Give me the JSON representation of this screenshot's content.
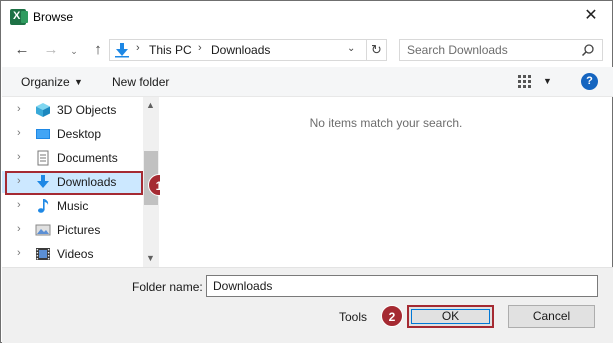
{
  "window": {
    "title": "Browse",
    "app_icon": "excel-icon",
    "close_glyph": "✕"
  },
  "navigation": {
    "back_glyph": "←",
    "forward_glyph": "→",
    "recent_glyph": "⌄",
    "up_glyph": "↑"
  },
  "address": {
    "icon": "downloads-folder-icon",
    "crumbs": [
      "This PC",
      "Downloads"
    ],
    "separator": "›",
    "dropdown_glyph": "⌄",
    "refresh_glyph": "↻"
  },
  "search": {
    "placeholder": "Search Downloads",
    "icon": "search-icon"
  },
  "toolbar": {
    "organize_label": "Organize",
    "organize_caret": "▼",
    "new_folder_label": "New folder",
    "view_caret": "▼",
    "help_label": "?"
  },
  "nav_pane": {
    "chevron": "›",
    "items": [
      {
        "label": "3D Objects",
        "icon": "3d-objects-icon",
        "selected": false
      },
      {
        "label": "Desktop",
        "icon": "desktop-icon",
        "selected": false
      },
      {
        "label": "Documents",
        "icon": "documents-icon",
        "selected": false
      },
      {
        "label": "Downloads",
        "icon": "downloads-icon",
        "selected": true
      },
      {
        "label": "Music",
        "icon": "music-icon",
        "selected": false
      },
      {
        "label": "Pictures",
        "icon": "pictures-icon",
        "selected": false
      },
      {
        "label": "Videos",
        "icon": "videos-icon",
        "selected": false
      }
    ],
    "scroll_up_glyph": "▲",
    "scroll_down_glyph": "▼"
  },
  "content": {
    "empty_message": "No items match your search."
  },
  "footer": {
    "folder_name_label": "Folder name:",
    "folder_name_value": "Downloads",
    "tools_label": "Tools",
    "ok_label": "OK",
    "cancel_label": "Cancel"
  },
  "annotations": {
    "badge_1": "1",
    "badge_2": "2",
    "highlight_color": "#a52a32"
  },
  "colors": {
    "selection": "#cce8ff",
    "accent": "#0078d7",
    "help": "#1565c0",
    "excel_green": "#1e7145"
  }
}
